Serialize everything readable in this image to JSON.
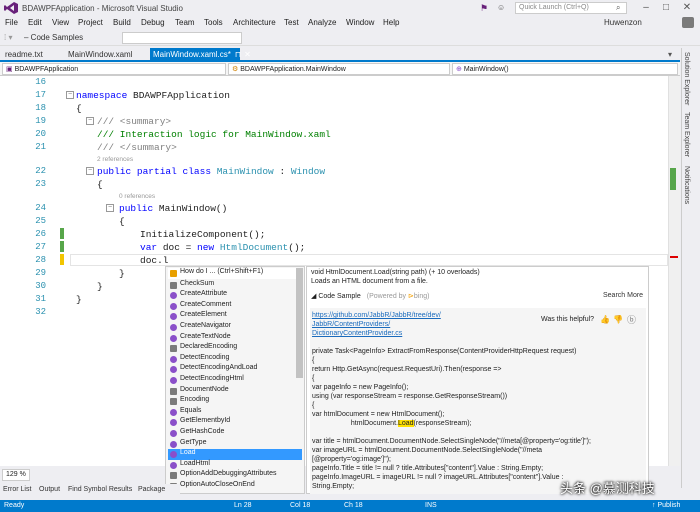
{
  "window": {
    "title": "BDAWPFApplication - Microsoft Visual Studio",
    "quick_launch_placeholder": "Quick Launch (Ctrl+Q)",
    "user": "Huwenzon"
  },
  "menu": [
    "File",
    "Edit",
    "View",
    "Project",
    "Build",
    "Debug",
    "Team",
    "Tools",
    "Architecture",
    "Test",
    "Analyze",
    "Window",
    "Help"
  ],
  "toolbar": {
    "dropdown_label": "Code Samples"
  },
  "doc_tabs": [
    "readme.txt",
    "MainWindow.xaml",
    "MainWindow.xaml.cs*"
  ],
  "nav": {
    "project": "BDAWPFApplication",
    "class": "BDAWPFApplication.MainWindow",
    "member": "MainWindow()"
  },
  "code_lines": [
    {
      "n": "16",
      "text": ""
    },
    {
      "n": "17",
      "text": "namespace BDAWPFApplication"
    },
    {
      "n": "18",
      "text": "{"
    },
    {
      "n": "19",
      "text": "/// <summary>"
    },
    {
      "n": "20",
      "text": "/// Interaction logic for MainWindow.xaml"
    },
    {
      "n": "21",
      "text": "/// </summary>"
    },
    {
      "n": "22",
      "text": "public partial class MainWindow : Window"
    },
    {
      "n": "23",
      "text": "{"
    },
    {
      "n": "24",
      "text": "public MainWindow()"
    },
    {
      "n": "25",
      "text": "{"
    },
    {
      "n": "26",
      "text": "InitializeComponent();"
    },
    {
      "n": "27",
      "text": "var doc = new HtmlDocument();"
    },
    {
      "n": "28",
      "text": "doc.l"
    },
    {
      "n": "29",
      "text": "}"
    },
    {
      "n": "30",
      "text": "}"
    },
    {
      "n": "31",
      "text": "}"
    },
    {
      "n": "32",
      "text": ""
    }
  ],
  "references": {
    "class_refs": "2 references",
    "ctor_refs": "0 references"
  },
  "intellisense": {
    "header": "How do I ... (Ctrl+Shift+F1)",
    "items": [
      "CheckSum",
      "CreateAttribute",
      "CreateComment",
      "CreateElement",
      "CreateNavigator",
      "CreateTextNode",
      "DeclaredEncoding",
      "DetectEncoding",
      "DetectEncodingAndLoad",
      "DetectEncodingHtml",
      "DocumentNode",
      "Encoding",
      "Equals",
      "GetElementbyId",
      "GetHashCode",
      "GetType",
      "Load",
      "LoadHtml",
      "OptionAddDebuggingAttributes",
      "OptionAutoCloseOnEnd"
    ],
    "selected": "Load"
  },
  "tooltip": {
    "signature": "void HtmlDocument.Load(string path) (+ 10 overloads)",
    "description": "Loads an HTML document from a file.",
    "code_sample_label": "Code Sample",
    "powered_by": "(Powered by",
    "bing": "bing)",
    "search_more": "Search More",
    "link": [
      "https://github.com/JabbR/JabbR/tree/dev/",
      "JabbR/ContentProviders/",
      "DictionaryContentProvider.cs"
    ],
    "helpful": "Was this helpful?",
    "sample_lines": [
      "private Task<PageInfo> ExtractFromResponse(ContentProviderHttpRequest request)",
      "        {",
      "            return Http.GetAsync(request.RequestUri).Then(response =>",
      "            {",
      "                var pageInfo = new PageInfo();",
      "                using (var responseStream = response.GetResponseStream())",
      "                {",
      "                    var htmlDocument = new HtmlDocument();",
      "                    htmlDocument.Load(responseStream);",
      "",
      "                    var title = htmlDocument.DocumentNode.SelectSingleNode(\"//meta[@property='og:title']\");",
      "                    var imageURL = htmlDocument.DocumentNode.SelectSingleNode(\"//meta",
      "[@property='og:image']\");",
      "                    pageInfo.Title = title != null ? title.Attributes[\"content\"].Value : String.Empty;",
      "                    pageInfo.ImageURL = imageURL != null ? imageURL.Attributes[\"content\"].Value :",
      "String.Empty;"
    ]
  },
  "zoom": "129 %",
  "bottom_tabs": [
    "Error List",
    "Output",
    "Find Symbol Results",
    "Package"
  ],
  "status": {
    "ready": "Ready",
    "ln": "Ln 28",
    "col": "Col 18",
    "ch": "Ch 18",
    "ins": "INS",
    "publish": "↑ Publish"
  },
  "side_tabs": [
    "Solution Explorer",
    "Team Explorer",
    "Notifications"
  ],
  "watermark": "头条 @慕测科技",
  "colors": {
    "accent": "#007acc",
    "keyword": "#0000ff",
    "type": "#2b91af",
    "comment": "#008000",
    "selection": "#3399ff"
  }
}
